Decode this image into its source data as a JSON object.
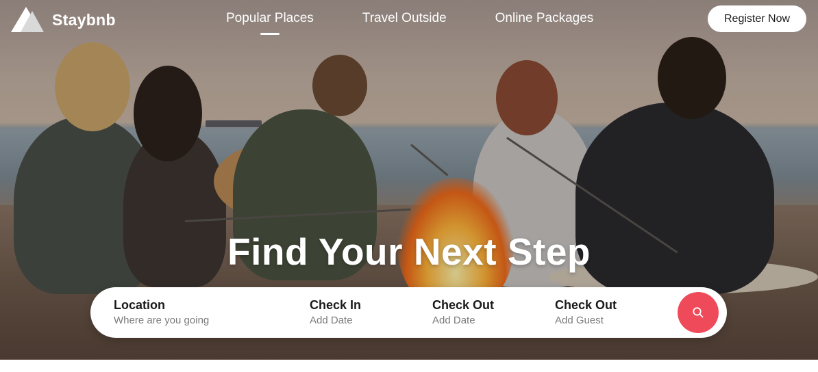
{
  "brand": {
    "name": "Staybnb",
    "logo_icon": "staybnb-triangle-logo"
  },
  "nav": {
    "items": [
      {
        "label": "Popular Places",
        "active": true
      },
      {
        "label": "Travel Outside",
        "active": false
      },
      {
        "label": "Online Packages",
        "active": false
      }
    ],
    "register_label": "Register Now"
  },
  "hero": {
    "headline": "Find Your Next Step",
    "image": "friends-beach-campfire"
  },
  "search": {
    "fields": [
      {
        "label": "Location",
        "value": "Where are you going"
      },
      {
        "label": "Check In",
        "value": "Add Date"
      },
      {
        "label": "Check Out",
        "value": "Add Date"
      },
      {
        "label": "Check Out",
        "value": "Add Guest"
      }
    ],
    "button_icon": "search-icon"
  },
  "colors": {
    "accent": "#ef4a5a",
    "text_primary": "#1a1a1a",
    "text_secondary": "#7a7a7a"
  }
}
